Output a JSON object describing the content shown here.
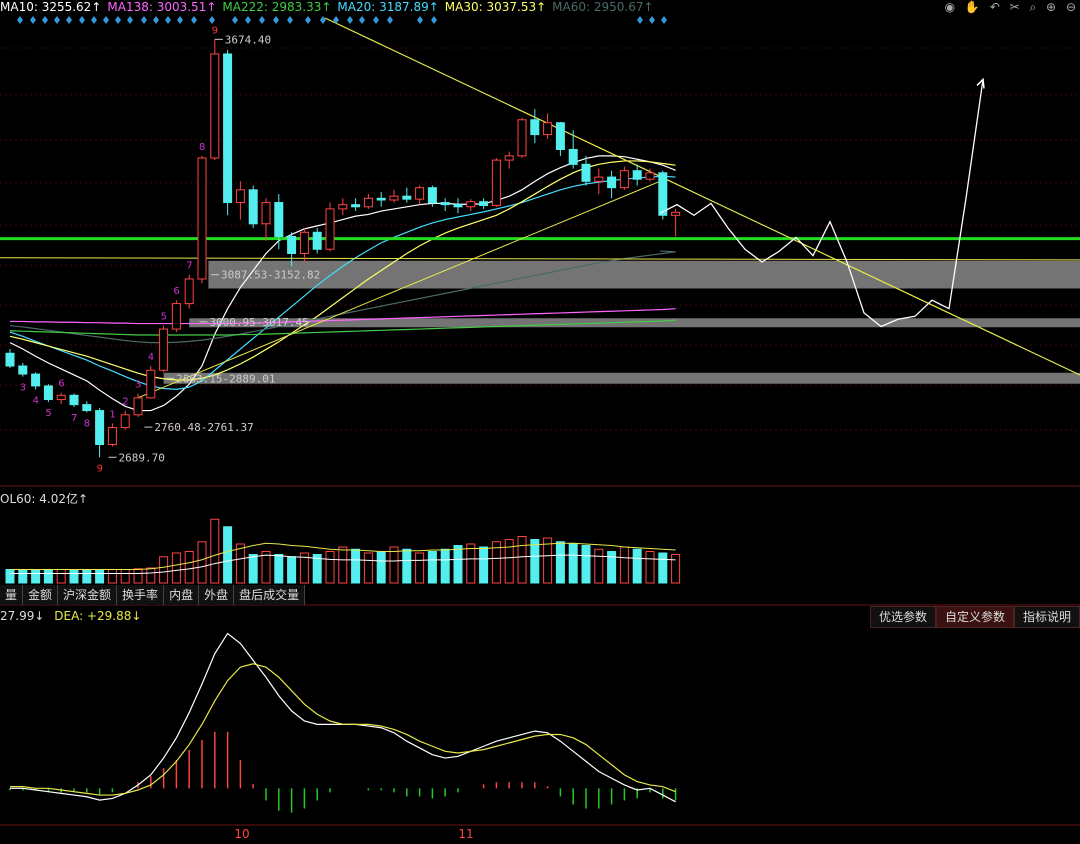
{
  "ma_legend": [
    {
      "text": "MA10: 3255.62↑",
      "color": "#ffffff"
    },
    {
      "text": "MA138: 3003.51↑",
      "color": "#ff66ff"
    },
    {
      "text": "MA222: 2983.33↑",
      "color": "#44cc44"
    },
    {
      "text": "MA20: 3187.89↑",
      "color": "#44ddff"
    },
    {
      "text": "MA30: 3037.53↑",
      "color": "#ffff66"
    },
    {
      "text": "MA60: 2950.67↑",
      "color": "#4a6a6a"
    }
  ],
  "tool_icons": [
    "eye-icon",
    "hand-icon",
    "undo-icon",
    "scissors-icon",
    "search-icon",
    "zoom-in-icon",
    "zoom-out-icon"
  ],
  "volume_label": "OL60: 4.02亿↑",
  "tabs": [
    "量",
    "金额",
    "沪深金额",
    "换手率",
    "内盘",
    "外盘",
    "盘后成交量"
  ],
  "macd_label": {
    "dif": "27.99↓",
    "dea": "DEA: +29.88↓"
  },
  "param_buttons": [
    "优选参数",
    "自定义参数",
    "指标说明"
  ],
  "colors": {
    "up": "#ff4444",
    "down": "#55eeee",
    "trend": "#e8e84a",
    "support": "#22dd22",
    "zone": "#888888"
  },
  "chart_data": {
    "type": "candlestick",
    "price_annotations": [
      "3674.40",
      "3087.53-3152.82",
      "3000.95-3017.45",
      "2863.15-2889.01",
      "2760.48-2761.37",
      "2689.70"
    ],
    "support_price": 3205,
    "zones": [
      [
        3087.53,
        3152.82
      ],
      [
        3000.95,
        3017.45
      ],
      [
        2863.15,
        2889.01
      ]
    ],
    "x_labels": [
      "10",
      "11"
    ],
    "candles": [
      {
        "o": 2935,
        "h": 2945,
        "l": 2900,
        "c": 2905,
        "n": ""
      },
      {
        "o": 2905,
        "h": 2912,
        "l": 2880,
        "c": 2886,
        "n": "3"
      },
      {
        "o": 2886,
        "h": 2890,
        "l": 2850,
        "c": 2858,
        "n": "4"
      },
      {
        "o": 2858,
        "h": 2862,
        "l": 2820,
        "c": 2826,
        "n": "5"
      },
      {
        "o": 2826,
        "h": 2842,
        "l": 2815,
        "c": 2836,
        "n": "6"
      },
      {
        "o": 2836,
        "h": 2840,
        "l": 2808,
        "c": 2814,
        "n": "7"
      },
      {
        "o": 2814,
        "h": 2822,
        "l": 2796,
        "c": 2800,
        "n": "8"
      },
      {
        "o": 2800,
        "h": 2806,
        "l": 2690,
        "c": 2720,
        "n": "9"
      },
      {
        "o": 2720,
        "h": 2770,
        "l": 2715,
        "c": 2760,
        "n": "1"
      },
      {
        "o": 2760,
        "h": 2800,
        "l": 2755,
        "c": 2790,
        "n": "2"
      },
      {
        "o": 2790,
        "h": 2840,
        "l": 2785,
        "c": 2830,
        "n": "3"
      },
      {
        "o": 2830,
        "h": 2905,
        "l": 2828,
        "c": 2895,
        "n": "4"
      },
      {
        "o": 2895,
        "h": 3000,
        "l": 2890,
        "c": 2992,
        "n": "5"
      },
      {
        "o": 2992,
        "h": 3060,
        "l": 2985,
        "c": 3052,
        "n": "6"
      },
      {
        "o": 3052,
        "h": 3120,
        "l": 3040,
        "c": 3110,
        "n": "7"
      },
      {
        "o": 3110,
        "h": 3400,
        "l": 3100,
        "c": 3395,
        "n": "8"
      },
      {
        "o": 3395,
        "h": 3674.4,
        "l": 3390,
        "c": 3640,
        "n": "9"
      },
      {
        "o": 3640,
        "h": 3650,
        "l": 3260,
        "c": 3290,
        "n": ""
      },
      {
        "o": 3290,
        "h": 3340,
        "l": 3250,
        "c": 3320,
        "n": ""
      },
      {
        "o": 3320,
        "h": 3330,
        "l": 3230,
        "c": 3240,
        "n": ""
      },
      {
        "o": 3240,
        "h": 3300,
        "l": 3200,
        "c": 3290,
        "n": ""
      },
      {
        "o": 3290,
        "h": 3310,
        "l": 3180,
        "c": 3210,
        "n": ""
      },
      {
        "o": 3210,
        "h": 3220,
        "l": 3140,
        "c": 3170,
        "n": ""
      },
      {
        "o": 3170,
        "h": 3230,
        "l": 3150,
        "c": 3220,
        "n": ""
      },
      {
        "o": 3220,
        "h": 3230,
        "l": 3170,
        "c": 3180,
        "n": ""
      },
      {
        "o": 3180,
        "h": 3290,
        "l": 3175,
        "c": 3275,
        "n": ""
      },
      {
        "o": 3275,
        "h": 3300,
        "l": 3260,
        "c": 3285,
        "n": ""
      },
      {
        "o": 3285,
        "h": 3300,
        "l": 3270,
        "c": 3280,
        "n": ""
      },
      {
        "o": 3280,
        "h": 3310,
        "l": 3275,
        "c": 3300,
        "n": ""
      },
      {
        "o": 3300,
        "h": 3315,
        "l": 3280,
        "c": 3296,
        "n": ""
      },
      {
        "o": 3296,
        "h": 3320,
        "l": 3290,
        "c": 3305,
        "n": ""
      },
      {
        "o": 3305,
        "h": 3325,
        "l": 3290,
        "c": 3298,
        "n": ""
      },
      {
        "o": 3298,
        "h": 3330,
        "l": 3285,
        "c": 3325,
        "n": ""
      },
      {
        "o": 3325,
        "h": 3330,
        "l": 3280,
        "c": 3290,
        "n": ""
      },
      {
        "o": 3290,
        "h": 3300,
        "l": 3270,
        "c": 3285,
        "n": ""
      },
      {
        "o": 3285,
        "h": 3300,
        "l": 3265,
        "c": 3280,
        "n": ""
      },
      {
        "o": 3280,
        "h": 3298,
        "l": 3270,
        "c": 3292,
        "n": ""
      },
      {
        "o": 3292,
        "h": 3300,
        "l": 3275,
        "c": 3283,
        "n": ""
      },
      {
        "o": 3283,
        "h": 3395,
        "l": 3280,
        "c": 3390,
        "n": ""
      },
      {
        "o": 3390,
        "h": 3410,
        "l": 3370,
        "c": 3400,
        "n": ""
      },
      {
        "o": 3400,
        "h": 3490,
        "l": 3395,
        "c": 3485,
        "n": ""
      },
      {
        "o": 3485,
        "h": 3510,
        "l": 3430,
        "c": 3450,
        "n": ""
      },
      {
        "o": 3450,
        "h": 3500,
        "l": 3440,
        "c": 3478,
        "n": ""
      },
      {
        "o": 3478,
        "h": 3480,
        "l": 3400,
        "c": 3415,
        "n": ""
      },
      {
        "o": 3415,
        "h": 3460,
        "l": 3370,
        "c": 3380,
        "n": ""
      },
      {
        "o": 3380,
        "h": 3400,
        "l": 3330,
        "c": 3340,
        "n": ""
      },
      {
        "o": 3340,
        "h": 3370,
        "l": 3310,
        "c": 3350,
        "n": ""
      },
      {
        "o": 3350,
        "h": 3365,
        "l": 3300,
        "c": 3325,
        "n": ""
      },
      {
        "o": 3325,
        "h": 3375,
        "l": 3320,
        "c": 3365,
        "n": ""
      },
      {
        "o": 3365,
        "h": 3380,
        "l": 3330,
        "c": 3345,
        "n": ""
      },
      {
        "o": 3345,
        "h": 3370,
        "l": 3340,
        "c": 3360,
        "n": ""
      },
      {
        "o": 3360,
        "h": 3365,
        "l": 3250,
        "c": 3260,
        "n": ""
      },
      {
        "o": 3260,
        "h": 3275,
        "l": 3210,
        "c": 3267,
        "n": ""
      }
    ],
    "ma_lines": [
      {
        "name": "MA10",
        "color": "#ffffff",
        "values": [
          2960,
          2945,
          2928,
          2912,
          2898,
          2884,
          2870,
          2848,
          2828,
          2810,
          2800,
          2800,
          2812,
          2834,
          2862,
          2905,
          2980,
          3040,
          3090,
          3130,
          3170,
          3200,
          3215,
          3228,
          3235,
          3242,
          3250,
          3258,
          3262,
          3270,
          3275,
          3280,
          3285,
          3288,
          3288,
          3286,
          3286,
          3287,
          3295,
          3305,
          3320,
          3340,
          3358,
          3372,
          3384,
          3394,
          3400,
          3400,
          3398,
          3392,
          3386,
          3378,
          3366
        ]
      },
      {
        "name": "MA20",
        "color": "#44ddff",
        "values": [
          2985,
          2975,
          2963,
          2952,
          2941,
          2930,
          2919,
          2905,
          2893,
          2880,
          2868,
          2858,
          2852,
          2850,
          2855,
          2870,
          2895,
          2920,
          2945,
          2970,
          2995,
          3020,
          3045,
          3070,
          3095,
          3118,
          3140,
          3160,
          3178,
          3195,
          3208,
          3220,
          3232,
          3242,
          3250,
          3256,
          3262,
          3268,
          3275,
          3282,
          3290,
          3300,
          3310,
          3320,
          3328,
          3334,
          3338,
          3342,
          3345,
          3348,
          3350,
          3352,
          3350
        ]
      },
      {
        "name": "MA30",
        "color": "#ffff66",
        "values": [
          2975,
          2968,
          2960,
          2952,
          2944,
          2936,
          2928,
          2918,
          2908,
          2898,
          2888,
          2880,
          2875,
          2872,
          2872,
          2876,
          2884,
          2896,
          2910,
          2926,
          2944,
          2962,
          2982,
          3002,
          3022,
          3044,
          3066,
          3088,
          3110,
          3130,
          3150,
          3170,
          3188,
          3204,
          3218,
          3230,
          3240,
          3250,
          3260,
          3275,
          3292,
          3310,
          3328,
          3345,
          3360,
          3372,
          3380,
          3385,
          3388,
          3388,
          3386,
          3382,
          3378
        ]
      },
      {
        "name": "MA60",
        "color": "#4a6a6a",
        "values": [
          3000,
          2997,
          2993,
          2989,
          2985,
          2981,
          2977,
          2973,
          2969,
          2965,
          2962,
          2960,
          2960,
          2961,
          2963,
          2966,
          2970,
          2975,
          2980,
          2986,
          2992,
          2998,
          3004,
          3010,
          3016,
          3022,
          3028,
          3034,
          3040,
          3046,
          3052,
          3058,
          3064,
          3070,
          3076,
          3082,
          3088,
          3094,
          3100,
          3106,
          3112,
          3118,
          3124,
          3130,
          3136,
          3142,
          3148,
          3153,
          3158,
          3162,
          3166,
          3170,
          3174
        ]
      },
      {
        "name": "MA138",
        "color": "#ff66ff",
        "values": [
          3010,
          3010,
          3009,
          3009,
          3008,
          3008,
          3007,
          3007,
          3006,
          3006,
          3005,
          3005,
          3005,
          3005,
          3005,
          3005,
          3005,
          3005,
          3006,
          3006,
          3007,
          3008,
          3009,
          3010,
          3011,
          3012,
          3013,
          3014,
          3015,
          3016,
          3017,
          3018,
          3019,
          3020,
          3021,
          3022,
          3023,
          3024,
          3025,
          3026,
          3027,
          3028,
          3029,
          3030,
          3031,
          3032,
          3033,
          3034,
          3035,
          3036,
          3037,
          3038,
          3040
        ]
      },
      {
        "name": "MA222",
        "color": "#44cc44",
        "values": [
          2988,
          2987,
          2986,
          2985,
          2984,
          2983,
          2982,
          2981,
          2980,
          2979,
          2978,
          2978,
          2978,
          2978,
          2978,
          2978,
          2978,
          2978,
          2979,
          2979,
          2980,
          2981,
          2982,
          2983,
          2984,
          2985,
          2986,
          2987,
          2988,
          2989,
          2990,
          2991,
          2992,
          2993,
          2994,
          2995,
          2996,
          2997,
          2998,
          2999,
          3000,
          3001,
          3002,
          3003,
          3004,
          3005,
          3006,
          3007,
          3008,
          3009,
          3010,
          3011,
          3013
        ]
      }
    ],
    "projection": [
      3265,
      3285,
      3260,
      3288,
      3230,
      3180,
      3150,
      3175,
      3208,
      3165,
      3245,
      3150,
      3030,
      2998,
      3015,
      3022,
      3060,
      3040,
      3300,
      3580
    ],
    "volume": {
      "ylim": [
        0,
        100
      ],
      "values": [
        18,
        18,
        18,
        18,
        18,
        18,
        18,
        18,
        18,
        18,
        19,
        20,
        35,
        40,
        42,
        55,
        85,
        75,
        52,
        38,
        42,
        38,
        35,
        40,
        38,
        42,
        48,
        45,
        40,
        42,
        48,
        45,
        40,
        42,
        45,
        50,
        52,
        48,
        55,
        58,
        62,
        58,
        60,
        55,
        52,
        50,
        45,
        42,
        48,
        45,
        42,
        40,
        38
      ],
      "ma": [
        18,
        18,
        18,
        18,
        18,
        18,
        18,
        18,
        18,
        18,
        18,
        19,
        21,
        24,
        27,
        31,
        37,
        42,
        46,
        50,
        53,
        52,
        50,
        49,
        47,
        45,
        44,
        44,
        43,
        42,
        42,
        43,
        43,
        44,
        44,
        45,
        46,
        46,
        47,
        48,
        50,
        51,
        52,
        53,
        53,
        52,
        51,
        50,
        48,
        47,
        46,
        45,
        44
      ]
    },
    "macd": {
      "ylim": [
        -20,
        100
      ],
      "dif": [
        0,
        0,
        -1,
        -2,
        -3,
        -4,
        -5,
        -7,
        -6,
        -3,
        2,
        8,
        18,
        30,
        45,
        62,
        80,
        92,
        86,
        76,
        66,
        55,
        46,
        40,
        38,
        38,
        38,
        38,
        37,
        36,
        33,
        28,
        24,
        20,
        18,
        19,
        22,
        25,
        28,
        30,
        32,
        34,
        33,
        28,
        22,
        16,
        10,
        6,
        2,
        -1,
        0,
        -4,
        -8
      ],
      "dea": [
        1,
        1,
        0,
        0,
        -1,
        -2,
        -3,
        -4,
        -4,
        -3,
        -1,
        2,
        8,
        16,
        26,
        38,
        52,
        64,
        72,
        74,
        72,
        66,
        58,
        50,
        44,
        40,
        38,
        38,
        38,
        37,
        35,
        32,
        28,
        25,
        22,
        21,
        22,
        23,
        25,
        27,
        29,
        31,
        32,
        32,
        30,
        26,
        20,
        14,
        8,
        4,
        2,
        1,
        -2
      ],
      "hist": [
        -1,
        -1,
        -1,
        -2,
        -2,
        -2,
        -2,
        -3,
        -2,
        0,
        3,
        6,
        10,
        14,
        19,
        24,
        28,
        28,
        14,
        2,
        -6,
        -11,
        -12,
        -10,
        -6,
        -2,
        0,
        0,
        -1,
        -1,
        -2,
        -4,
        -4,
        -5,
        -4,
        -2,
        0,
        2,
        3,
        3,
        3,
        3,
        1,
        -4,
        -8,
        -10,
        -10,
        -8,
        -6,
        -5,
        -2,
        -5,
        -6
      ]
    }
  }
}
